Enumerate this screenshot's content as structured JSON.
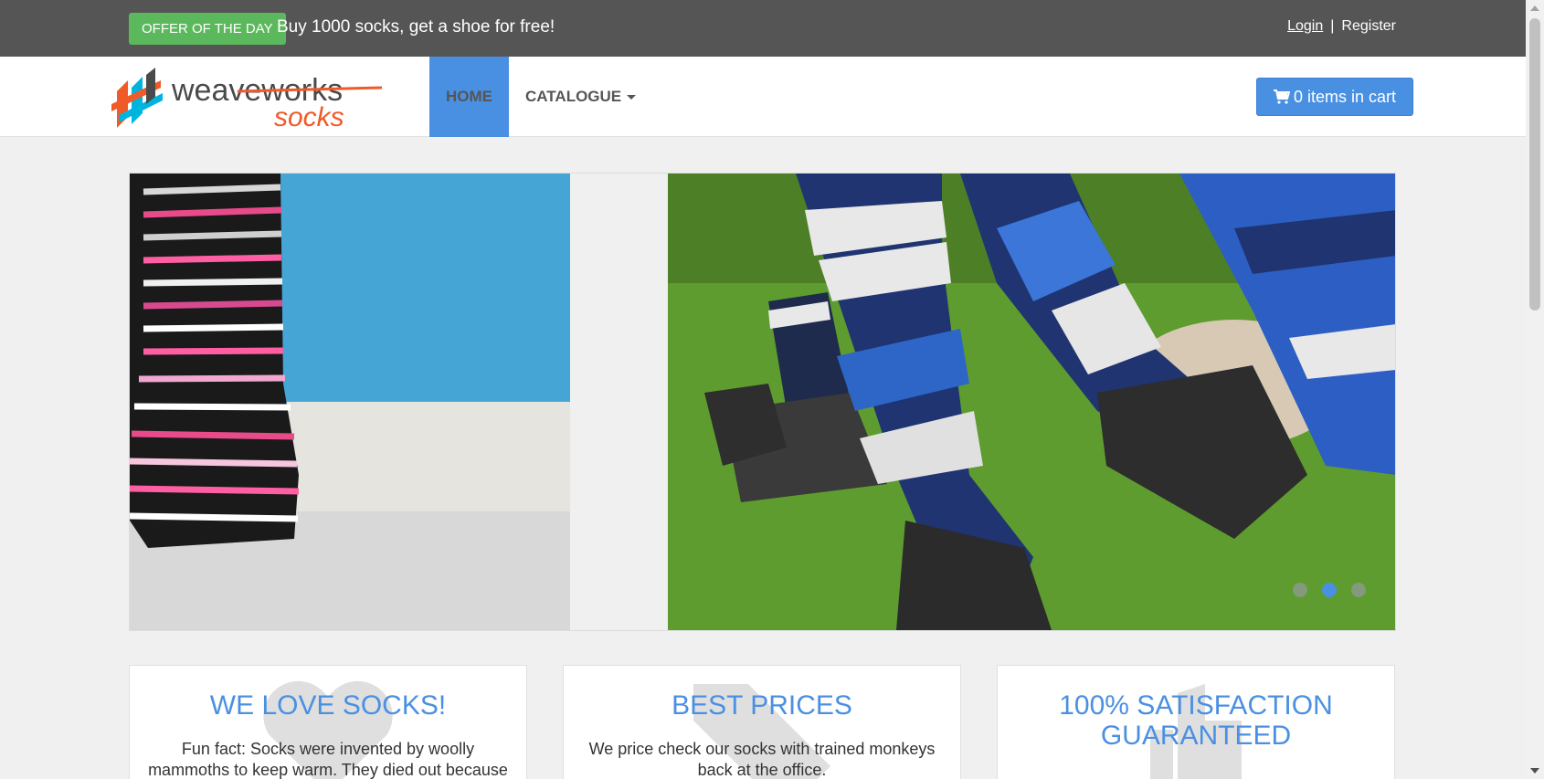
{
  "topbar": {
    "offer_badge": "OFFER OF THE DAY",
    "offer_text": "Buy 1000 socks, get a shoe for free!",
    "login": "Login",
    "separator": "|",
    "register": "Register"
  },
  "navbar": {
    "logo_text_1": "weaveworks",
    "logo_text_2": "socks",
    "home": "HOME",
    "catalogue": "CATALOGUE",
    "cart": "0 items in cart"
  },
  "carousel": {
    "slides": 3,
    "active_slide": 2
  },
  "features": [
    {
      "title": "WE LOVE SOCKS!",
      "text": "Fun fact: Socks were invented by woolly mammoths to keep warm. They died out because",
      "icon": "heart-icon"
    },
    {
      "title": "BEST PRICES",
      "text": "We price check our socks with trained monkeys back at the office.",
      "icon": "tag-icon"
    },
    {
      "title": "100% SATISFACTION GUARANTEED",
      "text": "",
      "icon": "thumbs-up-icon"
    }
  ],
  "colors": {
    "topbar": "#555555",
    "accent": "#4a90e2",
    "offer": "#5cb85c",
    "logo_orange": "#f05a28"
  }
}
